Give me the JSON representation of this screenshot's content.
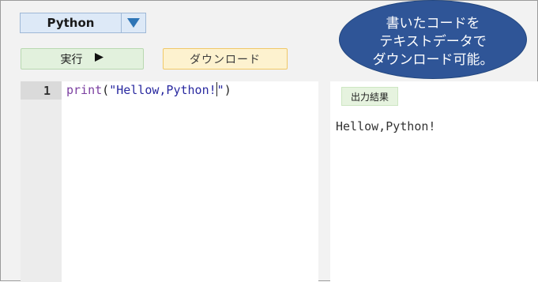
{
  "toolbar": {
    "language": "Python",
    "run_label": "実行",
    "download_label": "ダウンロード"
  },
  "editor": {
    "line_number": "1",
    "code_fn": "print",
    "code_open": "(",
    "code_str_a": "\"Hellow,Python!",
    "code_str_b": "\"",
    "code_close": ")"
  },
  "output": {
    "tab_label": "出力結果",
    "text": "Hellow,Python!"
  },
  "callout": {
    "line1": "書いたコードを",
    "line2": "テキストデータで",
    "line3": "ダウンロード可能。"
  },
  "colors": {
    "accent": "#2f5597",
    "run_bg": "#e2f1dd",
    "download_bg": "#fdf2cf"
  }
}
